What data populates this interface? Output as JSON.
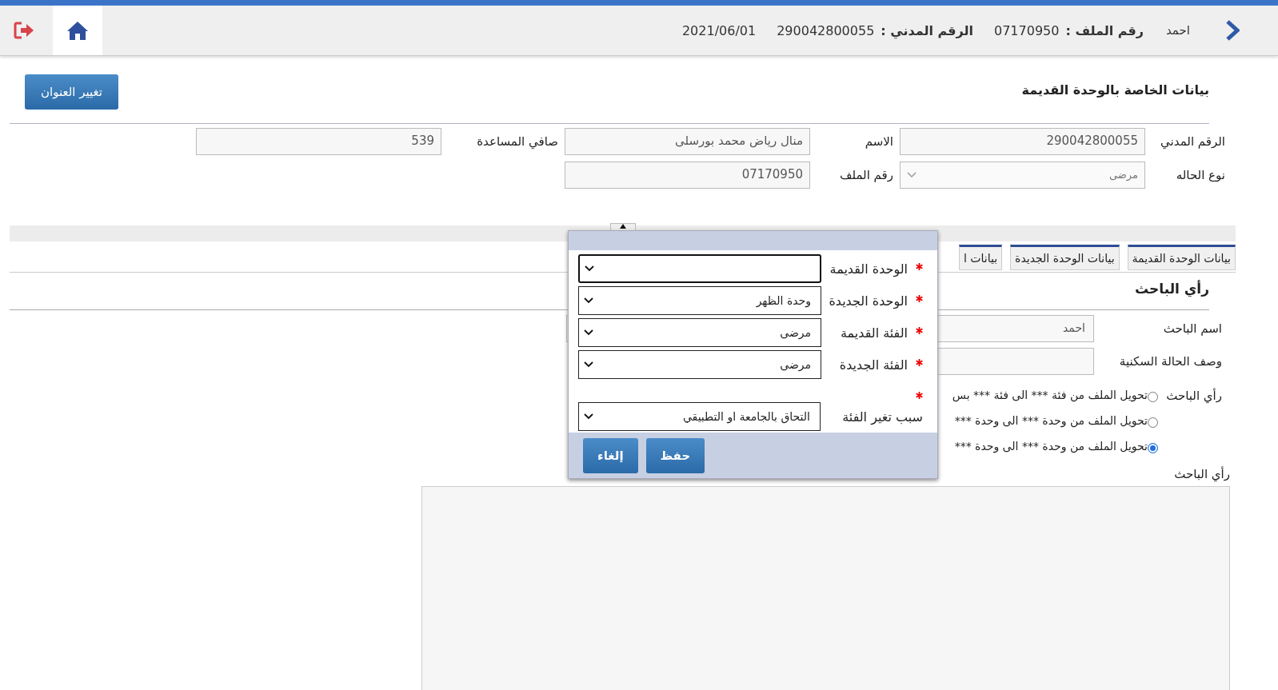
{
  "header": {
    "name": "احمد",
    "file_label": "رقم الملف :",
    "file_number": "07170950",
    "civil_label": "الرقم المدني :",
    "civil_number": "290042800055",
    "date": "2021/06/01"
  },
  "section": {
    "title": "بيانات الخاصة بالوحدة القديمة",
    "button": "تغيير العنوان",
    "fields": [
      {
        "label": "الرقم المدني",
        "kind": "input",
        "value": "290042800055"
      },
      {
        "label": "الاسم",
        "kind": "input",
        "value": "منال رياض محمد بورسلى"
      },
      {
        "label": "صافي المساعدة",
        "kind": "input",
        "value": "539"
      },
      {
        "label": "نوع الحاله",
        "kind": "select",
        "value": "مرضى"
      },
      {
        "label": "رقم الملف",
        "kind": "input",
        "value": "07170950"
      }
    ]
  },
  "tabs": [
    {
      "label": "بيانات الوحدة القديمة",
      "selected": false
    },
    {
      "label": "بيانات الوحدة الجديدة",
      "selected": false
    },
    {
      "label": "بيانات ا",
      "selected": false
    }
  ],
  "opinion": {
    "title": "رأي الباحث",
    "fields": [
      {
        "label": "اسم الباحث",
        "kind": "input",
        "value": "احمد"
      },
      {
        "label": "وصف الحالة السكنية",
        "kind": "input"
      }
    ],
    "side_control": {
      "kind": "select"
    },
    "choice_label": "رأي الباحث",
    "choices": [
      {
        "label": "تحويل الملف من فئة *** الى فئة *** بس",
        "selected": false
      },
      {
        "label": "تحويل الملف من وحدة *** الى وحدة ***",
        "selected": false
      },
      {
        "label": "تحويل الملف من وحدة *** الى وحدة ***",
        "selected": true
      }
    ],
    "notes_label": "رأي الباحث"
  },
  "modal": {
    "fields": [
      {
        "label": "الوحدة القديمة",
        "kind": "inline",
        "required": true,
        "focused": true
      },
      {
        "label": "الوحدة الجديدة",
        "kind": "inline",
        "required": true,
        "focused": false,
        "value": "وحدة الظهر"
      },
      {
        "label": "الفئة القديمة",
        "kind": "inline",
        "required": true,
        "focused": false,
        "value": "مرضى"
      },
      {
        "label": "الفئة الجديدة",
        "kind": "inline",
        "required": true,
        "focused": false,
        "value": "مرضى"
      },
      {
        "label": "سبب تغير الفئة",
        "kind": "stacked",
        "required": true,
        "focused": false,
        "value": "التحاق بالجامعة او التطبيقي"
      }
    ],
    "buttons": [
      {
        "label": "حفظ"
      },
      {
        "label": "إلغاء"
      }
    ]
  }
}
